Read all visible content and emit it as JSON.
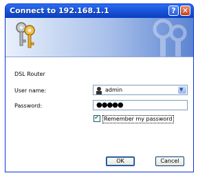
{
  "window": {
    "title": "Connect to 192.168.1.1",
    "help_label": "?",
    "close_label": "✕"
  },
  "banner": {
    "icon": "keys-icon"
  },
  "dialog": {
    "realm": "DSL Router",
    "username_label": "User name:",
    "username_value": "admin",
    "password_label": "Password:",
    "password_value": "●●●●●",
    "remember_label": "Remember my password",
    "remember_checked": true,
    "checkmark": "✔",
    "dropdown_arrow": "▼"
  },
  "buttons": {
    "ok": "OK",
    "cancel": "Cancel"
  },
  "colors": {
    "titlebar": "#1c58d8",
    "accent": "#0831d9",
    "dialog_bg": "#ffffff"
  }
}
